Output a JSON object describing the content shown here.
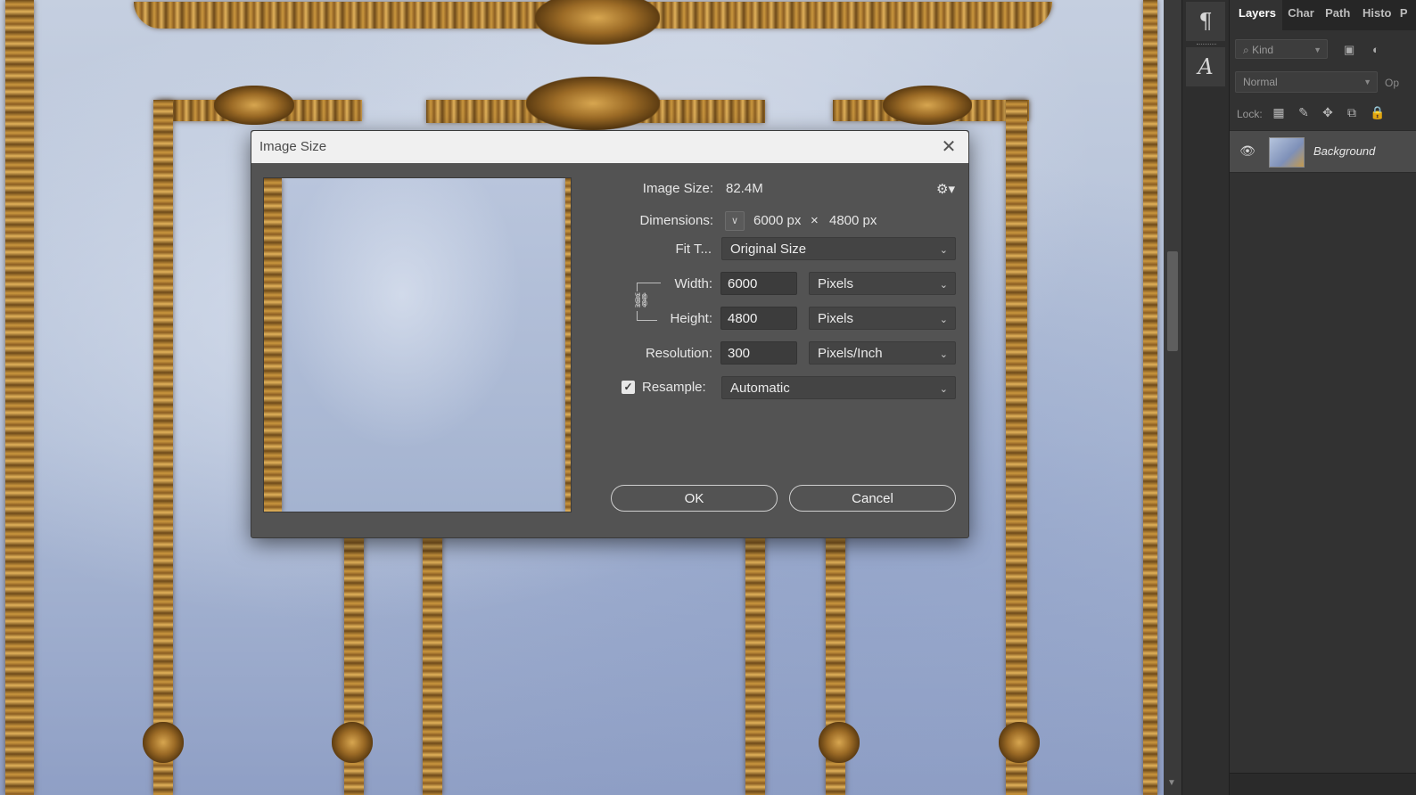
{
  "layers_panel": {
    "tabs": [
      "Layers",
      "Char",
      "Path",
      "Histo",
      "P"
    ],
    "kind_placeholder": "Kind",
    "blend_mode": "Normal",
    "opacity_label": "Op",
    "lock_label": "Lock:",
    "layer_name": "Background",
    "icons": [
      "search-icon",
      "image-filter-icon",
      "adjustment-filter-icon",
      "lock-pixels-icon",
      "brush-icon",
      "move-icon",
      "artboard-icon",
      "lock-icon",
      "eye-icon"
    ]
  },
  "tool_column": {
    "paragraph_glyph": "¶",
    "character_glyph": "A"
  },
  "dialog": {
    "title": "Image Size",
    "close_glyph": "✕",
    "image_size_label": "Image Size:",
    "image_size_value": "82.4M",
    "gear_glyph": "⚙▾",
    "dimensions_label": "Dimensions:",
    "dimensions_width": "6000 px",
    "dimensions_times": "×",
    "dimensions_height": "4800 px",
    "fit_to_label": "Fit T...",
    "fit_to_value": "Original Size",
    "width_label": "Width:",
    "width_value": "6000",
    "width_unit": "Pixels",
    "height_label": "Height:",
    "height_value": "4800",
    "height_unit": "Pixels",
    "resolution_label": "Resolution:",
    "resolution_value": "300",
    "resolution_unit": "Pixels/Inch",
    "resample_label": "Resample:",
    "resample_checked": true,
    "resample_value": "Automatic",
    "ok_label": "OK",
    "cancel_label": "Cancel"
  },
  "colors": {
    "dialog_bg": "#535353",
    "title_bar_bg": "#f0f0f0",
    "panel_bg": "#323232",
    "gold": "#c9963e",
    "canvas_blue": "#aebcd6"
  }
}
